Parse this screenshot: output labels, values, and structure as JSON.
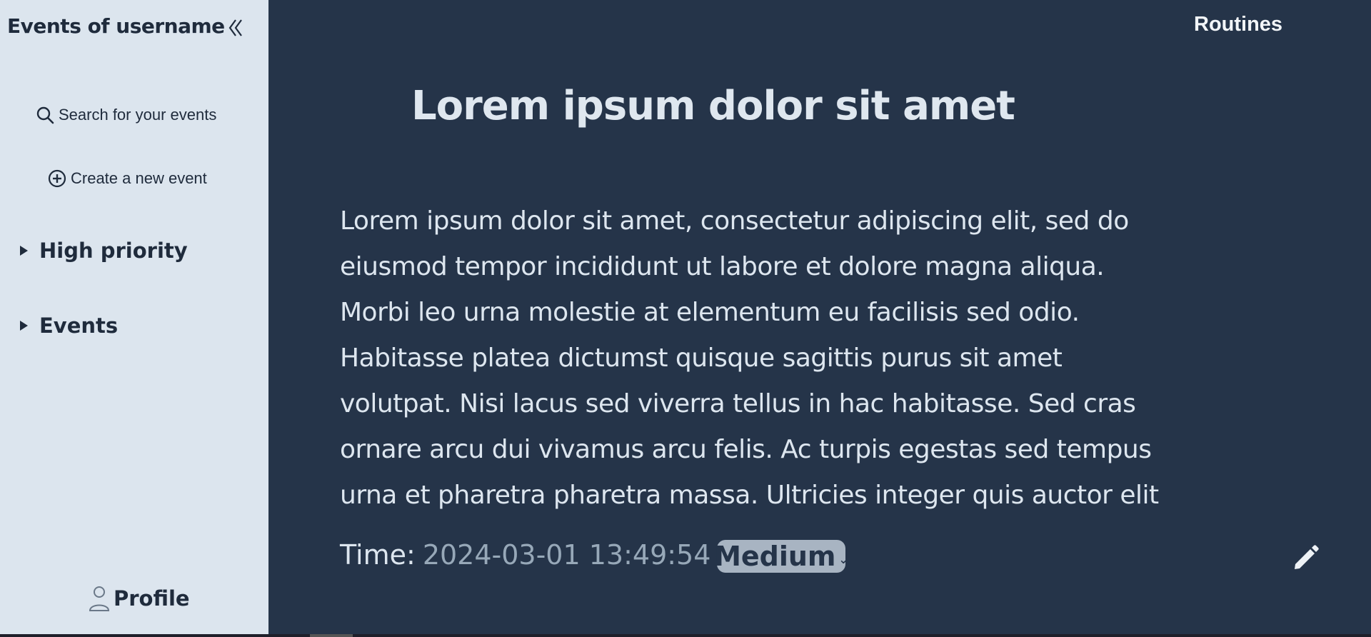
{
  "sidebar": {
    "title": "Events of username",
    "search_label": "Search for your events",
    "create_label": "Create a new event",
    "sections": [
      {
        "label": "High priority"
      },
      {
        "label": "Events"
      }
    ],
    "profile_label": "Profile"
  },
  "header": {
    "routines_label": "Routines"
  },
  "event": {
    "title": "Lorem ipsum dolor sit amet",
    "description": "Lorem ipsum dolor sit amet, consectetur adipiscing elit, sed do eiusmod tempor incididunt ut labore et dolore magna aliqua. Morbi leo urna molestie at elementum eu facilisis sed odio. Habitasse platea dictumst quisque sagittis purus sit amet volutpat. Nisi lacus sed viverra tellus in hac habitasse. Sed cras ornare arcu dui vivamus arcu felis. Ac turpis egestas sed tempus urna et pharetra pharetra massa. Ultricies integer quis auctor elit",
    "time_label": "Time:",
    "time_value": "2024-03-01 13:49:54",
    "priority_selected": "Medium"
  },
  "icons": {
    "collapse": "double-chevron-left-icon",
    "search": "search-icon",
    "create": "plus-circle-icon",
    "section_toggle": "triangle-right-icon",
    "profile": "user-icon",
    "edit": "pencil-icon",
    "priority_dropdown": "chevron-down-icon"
  },
  "colors": {
    "sidebar_bg": "#dce5ee",
    "main_bg": "#253449",
    "text_dark": "#1f2b3c",
    "text_light": "#dde6ef",
    "time_value": "#97a8b8",
    "priority_bg": "#a8b4c2"
  }
}
